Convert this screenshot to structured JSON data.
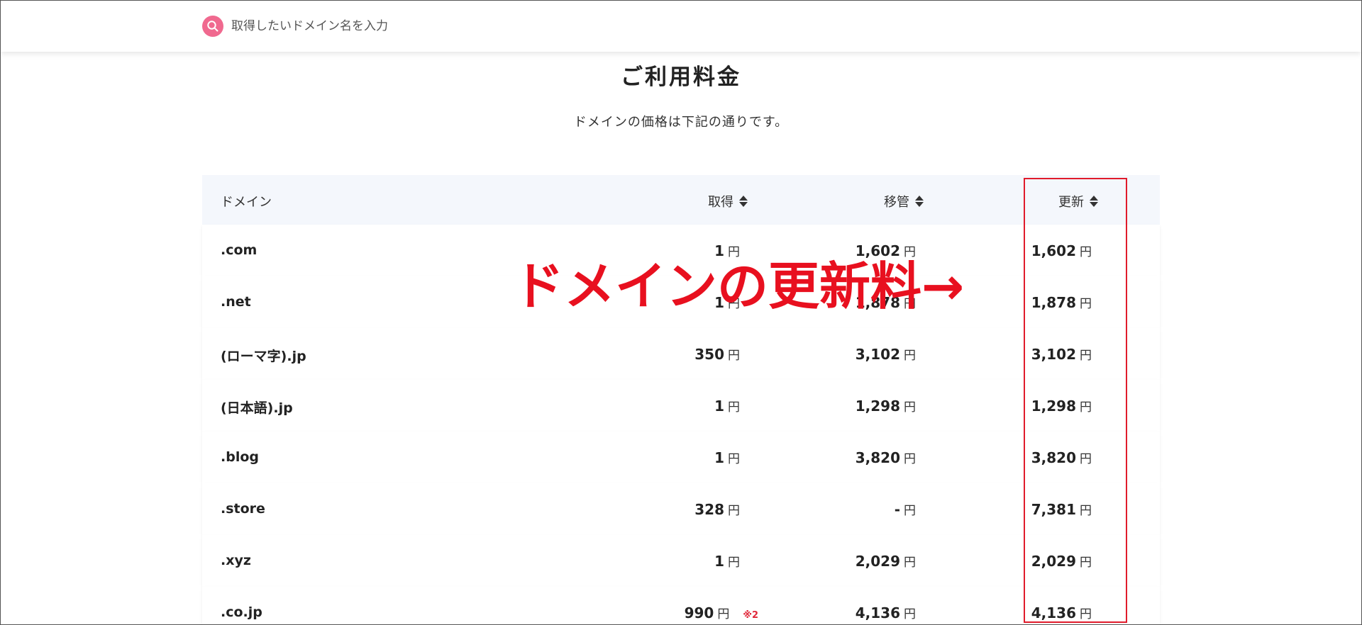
{
  "search": {
    "placeholder": "取得したいドメイン名を入力"
  },
  "page": {
    "title": "ご利用料金",
    "subtitle": "ドメインの価格は下記の通りです。"
  },
  "table": {
    "headers": {
      "domain": "ドメイン",
      "get": "取得",
      "transfer": "移管",
      "renew": "更新"
    },
    "currency": "円",
    "rows": [
      {
        "domain": ".com",
        "get": "1",
        "transfer": "1,602",
        "renew": "1,602",
        "note": ""
      },
      {
        "domain": ".net",
        "get": "1",
        "transfer": "1,878",
        "renew": "1,878",
        "note": ""
      },
      {
        "domain": "(ローマ字).jp",
        "get": "350",
        "transfer": "3,102",
        "renew": "3,102",
        "note": ""
      },
      {
        "domain": "(日本語).jp",
        "get": "1",
        "transfer": "1,298",
        "renew": "1,298",
        "note": ""
      },
      {
        "domain": ".blog",
        "get": "1",
        "transfer": "3,820",
        "renew": "3,820",
        "note": ""
      },
      {
        "domain": ".store",
        "get": "328",
        "transfer": "-",
        "renew": "7,381",
        "note": ""
      },
      {
        "domain": ".xyz",
        "get": "1",
        "transfer": "2,029",
        "renew": "2,029",
        "note": ""
      },
      {
        "domain": ".co.jp",
        "get": "990",
        "transfer": "4,136",
        "renew": "4,136",
        "note": "※2"
      }
    ]
  },
  "annotation": {
    "text": "ドメインの更新料→",
    "color": "#e8101f"
  },
  "colors": {
    "accent_pink": "#f0698f",
    "header_bg": "#f4f7fc",
    "highlight_red": "#e01b2b"
  }
}
